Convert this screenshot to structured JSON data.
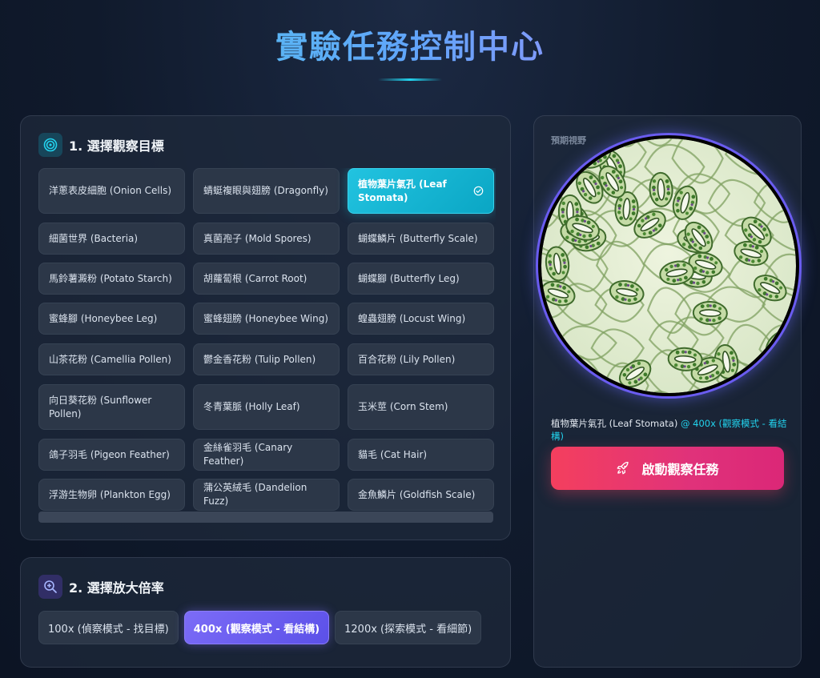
{
  "header": {
    "title": "實驗任務控制中心"
  },
  "targets": {
    "title": "1. 選擇觀察目標",
    "icon": "target-icon",
    "items": [
      {
        "label": "洋蔥表皮細胞 (Onion Cells)"
      },
      {
        "label": "蜻蜓複眼與翅膀 (Dragonfly)"
      },
      {
        "label": "植物葉片氣孔 (Leaf Stomata)",
        "selected": true
      },
      {
        "label": "細菌世界 (Bacteria)"
      },
      {
        "label": "真菌孢子 (Mold Spores)"
      },
      {
        "label": "蝴蝶鱗片 (Butterfly Scale)"
      },
      {
        "label": "馬鈴薯澱粉 (Potato Starch)"
      },
      {
        "label": "胡蘿蔔根 (Carrot Root)"
      },
      {
        "label": "蝴蝶腳 (Butterfly Leg)"
      },
      {
        "label": "蜜蜂腳 (Honeybee Leg)"
      },
      {
        "label": "蜜蜂翅膀 (Honeybee Wing)"
      },
      {
        "label": "蝗蟲翅膀 (Locust Wing)"
      },
      {
        "label": "山茶花粉 (Camellia Pollen)"
      },
      {
        "label": "鬱金香花粉 (Tulip Pollen)"
      },
      {
        "label": "百合花粉 (Lily Pollen)"
      },
      {
        "label": "向日葵花粉 (Sunflower Pollen)"
      },
      {
        "label": "冬青葉脈 (Holly Leaf)"
      },
      {
        "label": "玉米莖 (Corn Stem)"
      },
      {
        "label": "鴿子羽毛 (Pigeon Feather)"
      },
      {
        "label": "金絲雀羽毛 (Canary Feather)"
      },
      {
        "label": "貓毛 (Cat Hair)"
      },
      {
        "label": "浮游生物卵 (Plankton Egg)"
      },
      {
        "label": "蒲公英絨毛 (Dandelion Fuzz)"
      },
      {
        "label": "金魚鱗片 (Goldfish Scale)"
      },
      {
        "label": ""
      },
      {
        "label": ""
      },
      {
        "label": ""
      }
    ]
  },
  "magnification": {
    "title": "2. 選擇放大倍率",
    "icon": "zoom-in-icon",
    "options": [
      {
        "label": "100x (偵察模式 - 找目標)"
      },
      {
        "label": "400x (觀察模式 - 看結構)",
        "selected": true
      },
      {
        "label": "1200x (探索模式 - 看細節)"
      }
    ]
  },
  "preview": {
    "label": "預期視野",
    "caption_target": "植物葉片氣孔 (Leaf Stomata)",
    "caption_mag": "@ 400x (觀察模式 - 看結構)",
    "launch_label": "啟動觀察任務",
    "launch_icon": "rocket-icon"
  },
  "colors": {
    "accent_cyan": "#22d3ee",
    "accent_purple": "#7c6cf7",
    "launch_red": "#f43f5e",
    "panel_bg": "#1e293b"
  }
}
